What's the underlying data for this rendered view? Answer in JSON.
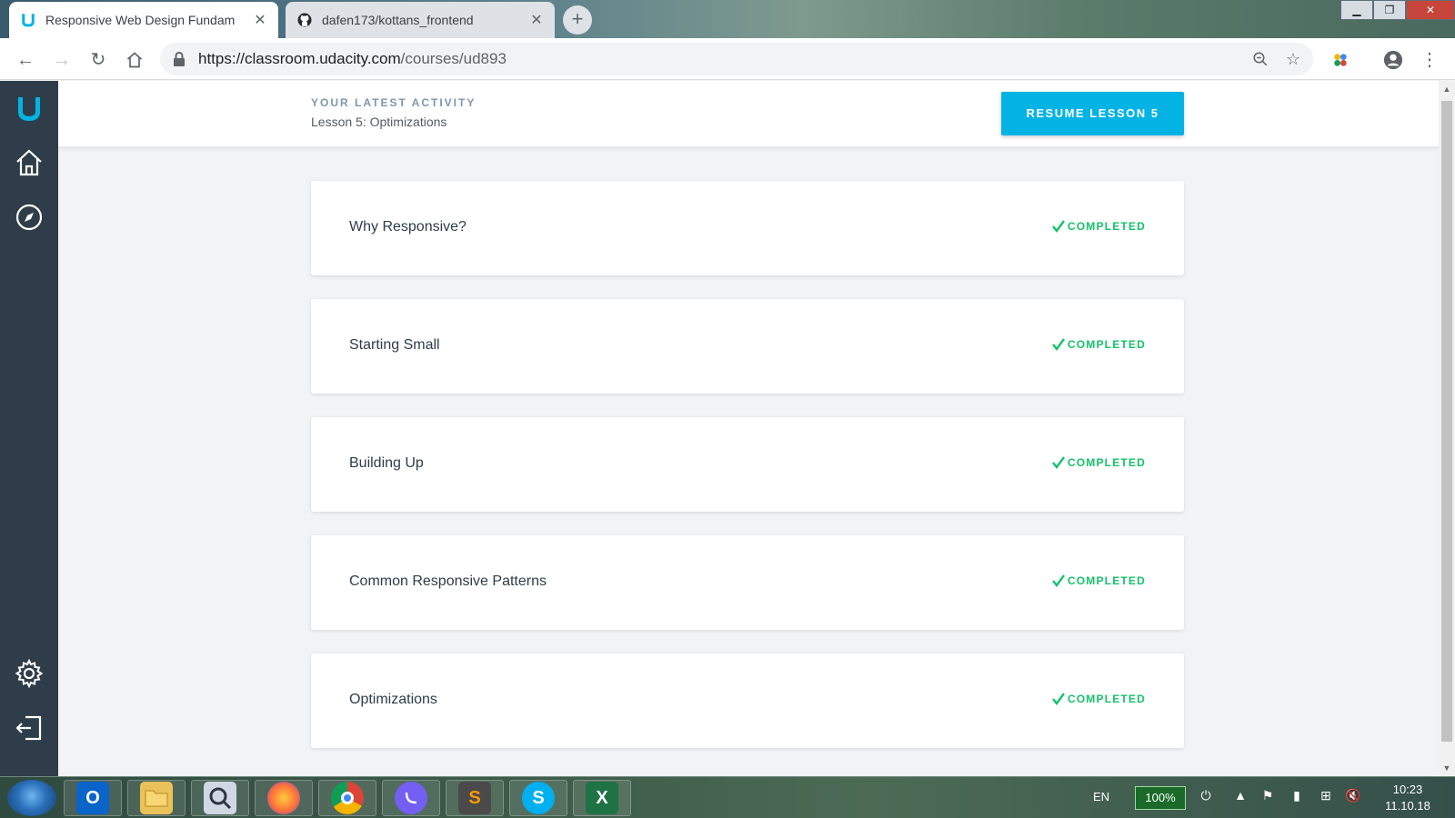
{
  "browser": {
    "tabs": [
      {
        "title": "Responsive Web Design Fundam",
        "active": true,
        "icon": "udacity-logo-icon"
      },
      {
        "title": "dafen173/kottans_frontend",
        "active": false,
        "icon": "github-icon"
      }
    ],
    "url_host": "https://classroom.udacity.com",
    "url_path": "/courses/ud893"
  },
  "activity": {
    "label": "YOUR LATEST ACTIVITY",
    "lesson": "Lesson 5: Optimizations",
    "resume_label": "RESUME LESSON 5"
  },
  "lessons": [
    {
      "title": "Why Responsive?",
      "status": "COMPLETED"
    },
    {
      "title": "Starting Small",
      "status": "COMPLETED"
    },
    {
      "title": "Building Up",
      "status": "COMPLETED"
    },
    {
      "title": "Common Responsive Patterns",
      "status": "COMPLETED"
    },
    {
      "title": "Optimizations",
      "status": "COMPLETED"
    }
  ],
  "taskbar": {
    "lang": "EN",
    "battery": "100%",
    "time": "10:23",
    "date": "11.10.18",
    "apps": [
      "outlook-icon",
      "file-explorer-icon",
      "search-tool-icon",
      "firefox-icon",
      "chrome-icon",
      "viber-icon",
      "sublime-text-icon",
      "skype-icon",
      "excel-icon"
    ]
  },
  "colors": {
    "accent": "#02b3e4",
    "completed": "#15c26b",
    "rail": "#2e3d49"
  }
}
